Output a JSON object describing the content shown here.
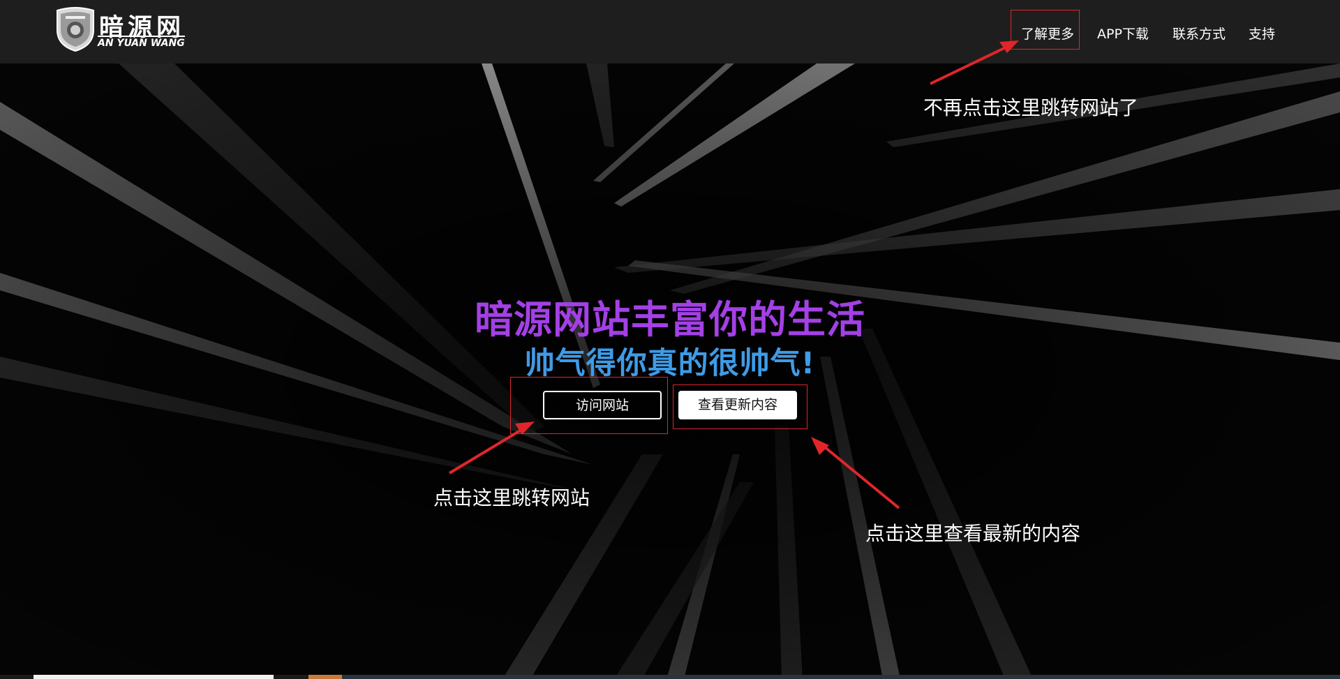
{
  "header": {
    "logo_title": "暗源网",
    "logo_subtitle": "AN YUAN WANG",
    "nav": [
      {
        "label": "了解更多"
      },
      {
        "label": "APP下载"
      },
      {
        "label": "联系方式"
      },
      {
        "label": "支持"
      }
    ]
  },
  "hero": {
    "headline": "暗源网站丰富你的生活",
    "subheadline": "帅气得你真的很帅气!",
    "buttons": {
      "visit_label": "访问网站",
      "updates_label": "查看更新内容"
    }
  },
  "annotations": {
    "nav_note": "不再点击这里跳转网站了",
    "visit_note": "点击这里跳转网站",
    "updates_note": "点击这里查看最新的内容"
  },
  "colors": {
    "navbar_bg": "#1e1e1e",
    "headline": "#a340e6",
    "subheadline": "#3f9be6",
    "annotation_red": "#e0262a"
  },
  "icons": {
    "logo_emblem": "shield-emblem-icon"
  }
}
